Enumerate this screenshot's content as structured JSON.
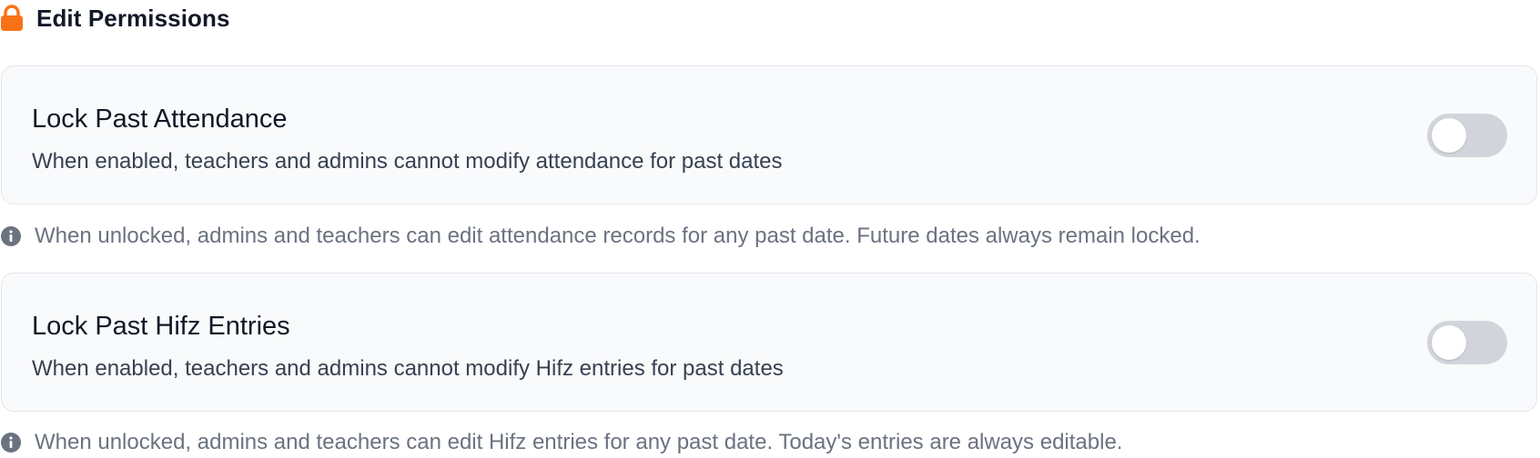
{
  "header": {
    "icon": "lock-icon",
    "title": "Edit Permissions"
  },
  "colors": {
    "accent": "#f97316",
    "toggle_off": "#d1d5db",
    "card_bg": "#f9fafb",
    "muted_text": "#6b7280"
  },
  "settings": [
    {
      "title": "Lock Past Attendance",
      "description": "When enabled, teachers and admins cannot modify attendance for past dates",
      "enabled": false,
      "note": "When unlocked, admins and teachers can edit attendance records for any past date. Future dates always remain locked."
    },
    {
      "title": "Lock Past Hifz Entries",
      "description": "When enabled, teachers and admins cannot modify Hifz entries for past dates",
      "enabled": false,
      "note": "When unlocked, admins and teachers can edit Hifz entries for any past date. Today's entries are always editable."
    }
  ]
}
